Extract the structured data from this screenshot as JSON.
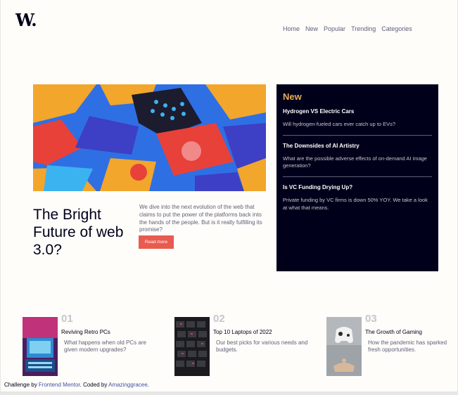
{
  "logo": "W.",
  "nav": [
    "Home",
    "New",
    "Popular",
    "Trending",
    "Categories"
  ],
  "hero": {
    "title": "The Bright Future of web 3.0?",
    "description": "We dive into the next evolution of the web that claims to put the power of the platforms back into the hands of the people. But is it really fulfilling its promise?",
    "button_label": "Read more"
  },
  "new_section": {
    "heading": "New",
    "items": [
      {
        "title": "Hydrogen VS Electric Cars",
        "text": "Will hydrogen-fueled cars ever catch up to EVs?"
      },
      {
        "title": "The Downsides of AI Artistry",
        "text": "What are the possible adverse effects of on-demand AI image generation?"
      },
      {
        "title": "Is VC Funding Drying Up?",
        "text": "Private funding by VC firms is down 50% YOY. We take a look at what that means."
      }
    ]
  },
  "cards": [
    {
      "number": "01",
      "title": "Reviving Retro PCs",
      "text": "What happens when old PCs are given modern upgrades?"
    },
    {
      "number": "02",
      "title": "Top 10 Laptops of 2022",
      "text": "Our best picks for various needs and budgets."
    },
    {
      "number": "03",
      "title": "The Growth of Gaming",
      "text": "How the pandemic has sparked fresh opportunities."
    }
  ],
  "footer": {
    "prefix": "Challenge by ",
    "link1": "Frontend Mentor",
    "middle": ". Coded by ",
    "link2": "Amazinggracee",
    "suffix": "."
  }
}
